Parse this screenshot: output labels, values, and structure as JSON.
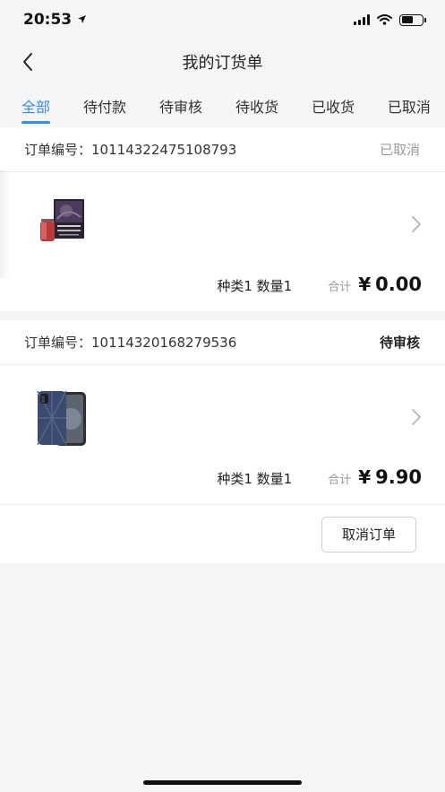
{
  "status_bar": {
    "time": "20:53"
  },
  "nav": {
    "title": "我的订货单"
  },
  "tabs": [
    {
      "label": "全部",
      "active": true
    },
    {
      "label": "待付款",
      "active": false
    },
    {
      "label": "待审核",
      "active": false
    },
    {
      "label": "待收货",
      "active": false
    },
    {
      "label": "已收货",
      "active": false
    },
    {
      "label": "已取消",
      "active": false
    }
  ],
  "orders": [
    {
      "order_no_label": "订单编号：",
      "order_no": "10114322475108793",
      "status": "已取消",
      "product_icon": "perfume-product-image",
      "kinds_qty": "种类1 数量1",
      "total_label": "合计",
      "currency": "¥",
      "amount": "0.00"
    },
    {
      "order_no_label": "订单编号：",
      "order_no": "10114320168279536",
      "status": "待审核",
      "product_icon": "phone-case-product-image",
      "kinds_qty": "种类1 数量1",
      "total_label": "合计",
      "currency": "¥",
      "amount": "9.90",
      "action_label": "取消订单"
    }
  ],
  "colors": {
    "accent": "#3d8be8",
    "cancelled": "#9a9aa0",
    "background": "#f4f5f7"
  }
}
